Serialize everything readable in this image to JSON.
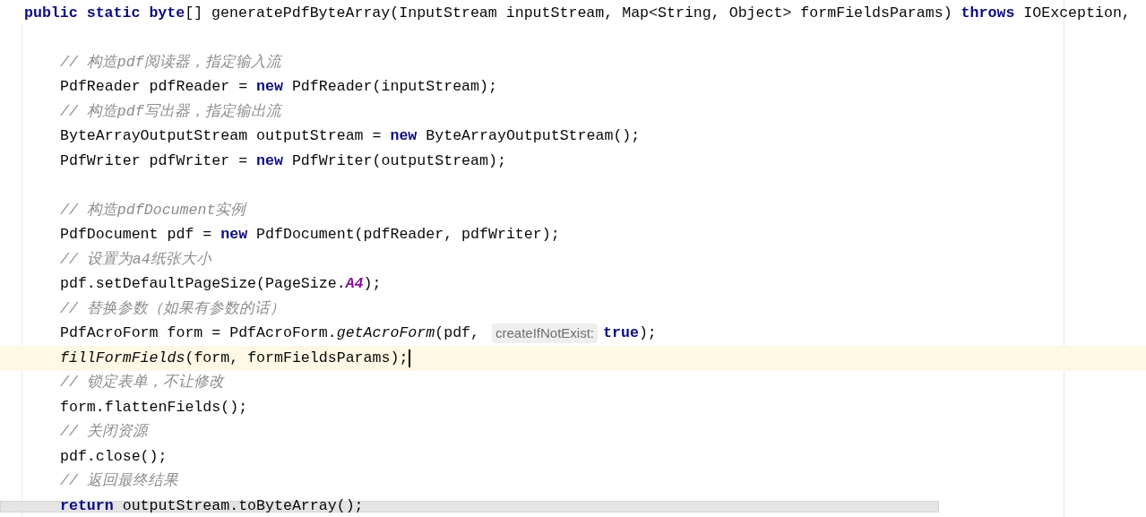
{
  "editor": {
    "lines": [
      {
        "current": false,
        "tokens": [
          {
            "kind": "keyword",
            "text": "public static byte"
          },
          {
            "kind": "plain",
            "text": "[] generatePdfByteArray(InputStream inputStream, Map<String, Object> formFieldsParams) "
          },
          {
            "kind": "keyword",
            "text": "throws"
          },
          {
            "kind": "plain",
            "text": " IOException,"
          }
        ],
        "children": [
          {
            "current": false
          },
          {
            "current": false,
            "tokens": [
              {
                "kind": "comment",
                "text": "// 构造pdf阅读器，指定输入流"
              }
            ]
          },
          {
            "current": false,
            "tokens": [
              {
                "kind": "plain",
                "text": "PdfReader pdfReader = "
              },
              {
                "kind": "keyword",
                "text": "new"
              },
              {
                "kind": "plain",
                "text": " PdfReader(inputStream);"
              }
            ]
          },
          {
            "current": false,
            "tokens": [
              {
                "kind": "comment",
                "text": "// 构造pdf写出器，指定输出流"
              }
            ]
          },
          {
            "current": false,
            "tokens": [
              {
                "kind": "plain",
                "text": "ByteArrayOutputStream outputStream = "
              },
              {
                "kind": "keyword",
                "text": "new"
              },
              {
                "kind": "plain",
                "text": " ByteArrayOutputStream();"
              }
            ]
          },
          {
            "current": false,
            "tokens": [
              {
                "kind": "plain",
                "text": "PdfWriter pdfWriter = "
              },
              {
                "kind": "keyword",
                "text": "new"
              },
              {
                "kind": "plain",
                "text": " PdfWriter(outputStream);"
              }
            ]
          },
          {
            "current": false
          },
          {
            "current": false,
            "tokens": [
              {
                "kind": "comment",
                "text": "// 构造pdfDocument实例"
              }
            ]
          },
          {
            "current": false,
            "tokens": [
              {
                "kind": "plain",
                "text": "PdfDocument pdf = "
              },
              {
                "kind": "keyword",
                "text": "new"
              },
              {
                "kind": "plain",
                "text": " PdfDocument(pdfReader, pdfWriter);"
              }
            ]
          },
          {
            "current": false,
            "tokens": [
              {
                "kind": "comment",
                "text": "// 设置为a4纸张大小"
              }
            ]
          },
          {
            "current": false,
            "tokens": [
              {
                "kind": "plain",
                "text": "pdf.setDefaultPageSize(PageSize."
              },
              {
                "kind": "constant",
                "text": "A4"
              },
              {
                "kind": "plain",
                "text": ");"
              }
            ]
          },
          {
            "current": false,
            "tokens": [
              {
                "kind": "comment",
                "text": "// 替换参数（如果有参数的话）"
              }
            ]
          },
          {
            "current": false,
            "tokens": [
              {
                "kind": "plain",
                "text": "PdfAcroForm form = PdfAcroForm."
              },
              {
                "kind": "static",
                "text": "getAcroForm"
              },
              {
                "kind": "plain",
                "text": "(pdf, "
              },
              {
                "kind": "hint",
                "text": "createIfNotExist:"
              },
              {
                "kind": "keyword",
                "text": "true"
              },
              {
                "kind": "plain",
                "text": ");"
              }
            ]
          },
          {
            "current": true,
            "tokens": [
              {
                "kind": "static",
                "text": "fillFormFields"
              },
              {
                "kind": "plain",
                "text": "(form, formFieldsParams);"
              }
            ]
          },
          {
            "current": false,
            "tokens": [
              {
                "kind": "comment",
                "text": "// 锁定表单，不让修改"
              }
            ]
          },
          {
            "current": false,
            "tokens": [
              {
                "kind": "plain",
                "text": "form.flattenFields();"
              }
            ]
          },
          {
            "current": false,
            "tokens": [
              {
                "kind": "comment",
                "text": "// 关闭资源"
              }
            ]
          },
          {
            "current": false,
            "tokens": [
              {
                "kind": "plain",
                "text": "pdf.close();"
              }
            ]
          },
          {
            "current": false,
            "tokens": [
              {
                "kind": "comment",
                "text": "// 返回最终结果"
              }
            ]
          },
          {
            "current": false,
            "tokens": [
              {
                "kind": "keyword",
                "text": "return"
              },
              {
                "kind": "plain",
                "text": " outputStream.toByteArray();"
              }
            ]
          }
        ]
      }
    ]
  }
}
